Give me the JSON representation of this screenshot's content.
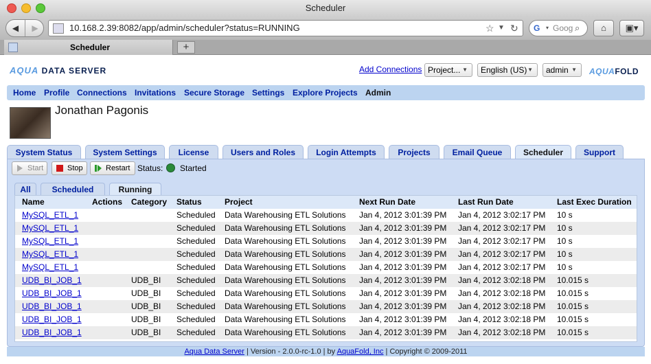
{
  "window": {
    "title": "Scheduler"
  },
  "browser": {
    "url": "10.168.2.39:8082/app/admin/scheduler?status=RUNNING",
    "search_placeholder": "Goog",
    "tab_title": "Scheduler"
  },
  "header": {
    "logo_text": "AQUA",
    "logo_sub": "DATA SERVER",
    "add_connections": "Add Connections",
    "project_select": "Project...",
    "language_select": "English (US)",
    "user_select": "admin",
    "brand_right_a": "AQUA",
    "brand_right_b": "FOLD"
  },
  "menu": [
    "Home",
    "Profile",
    "Connections",
    "Invitations",
    "Secure Storage",
    "Settings",
    "Explore Projects",
    "Admin"
  ],
  "user": {
    "name": "Jonathan Pagonis"
  },
  "admin_tabs": [
    "System Status",
    "System Settings",
    "License",
    "Users and Roles",
    "Login Attempts",
    "Projects",
    "Email Queue",
    "Scheduler",
    "Support"
  ],
  "controls": {
    "start": "Start",
    "stop": "Stop",
    "restart": "Restart",
    "status_label": "Status:",
    "status_value": "Started"
  },
  "sub_tabs": [
    "All",
    "Scheduled",
    "Running"
  ],
  "table": {
    "columns": [
      "Name",
      "Actions",
      "Category",
      "Status",
      "Project",
      "Next Run Date",
      "Last Run Date",
      "Last Exec Duration"
    ],
    "rows": [
      [
        "MySQL_ETL_1",
        "",
        "",
        "Scheduled",
        "Data Warehousing ETL Solutions",
        "Jan 4, 2012 3:01:39 PM",
        "Jan 4, 2012 3:02:17 PM",
        "10 s"
      ],
      [
        "MySQL_ETL_1",
        "",
        "",
        "Scheduled",
        "Data Warehousing ETL Solutions",
        "Jan 4, 2012 3:01:39 PM",
        "Jan 4, 2012 3:02:17 PM",
        "10 s"
      ],
      [
        "MySQL_ETL_1",
        "",
        "",
        "Scheduled",
        "Data Warehousing ETL Solutions",
        "Jan 4, 2012 3:01:39 PM",
        "Jan 4, 2012 3:02:17 PM",
        "10 s"
      ],
      [
        "MySQL_ETL_1",
        "",
        "",
        "Scheduled",
        "Data Warehousing ETL Solutions",
        "Jan 4, 2012 3:01:39 PM",
        "Jan 4, 2012 3:02:17 PM",
        "10 s"
      ],
      [
        "MySQL_ETL_1",
        "",
        "",
        "Scheduled",
        "Data Warehousing ETL Solutions",
        "Jan 4, 2012 3:01:39 PM",
        "Jan 4, 2012 3:02:17 PM",
        "10 s"
      ],
      [
        "UDB_BI_JOB_1",
        "",
        "UDB_BI",
        "Scheduled",
        "Data Warehousing ETL Solutions",
        "Jan 4, 2012 3:01:39 PM",
        "Jan 4, 2012 3:02:18 PM",
        "10.015 s"
      ],
      [
        "UDB_BI_JOB_1",
        "",
        "UDB_BI",
        "Scheduled",
        "Data Warehousing ETL Solutions",
        "Jan 4, 2012 3:01:39 PM",
        "Jan 4, 2012 3:02:18 PM",
        "10.015 s"
      ],
      [
        "UDB_BI_JOB_1",
        "",
        "UDB_BI",
        "Scheduled",
        "Data Warehousing ETL Solutions",
        "Jan 4, 2012 3:01:39 PM",
        "Jan 4, 2012 3:02:18 PM",
        "10.015 s"
      ],
      [
        "UDB_BI_JOB_1",
        "",
        "UDB_BI",
        "Scheduled",
        "Data Warehousing ETL Solutions",
        "Jan 4, 2012 3:01:39 PM",
        "Jan 4, 2012 3:02:18 PM",
        "10.015 s"
      ],
      [
        "UDB_BI_JOB_1",
        "",
        "UDB_BI",
        "Scheduled",
        "Data Warehousing ETL Solutions",
        "Jan 4, 2012 3:01:39 PM",
        "Jan 4, 2012 3:02:18 PM",
        "10.015 s"
      ]
    ]
  },
  "footer": {
    "product_link": "Aqua Data Server",
    "version": " | Version - 2.0.0-rc-1.0 | by ",
    "company_link": "AquaFold, Inc",
    "copyright": " | Copyright © 2009-2011"
  },
  "colors": {
    "menu_bg": "#bcd4f0",
    "link": "#0000cc",
    "panel_bg": "#cddcf4"
  }
}
